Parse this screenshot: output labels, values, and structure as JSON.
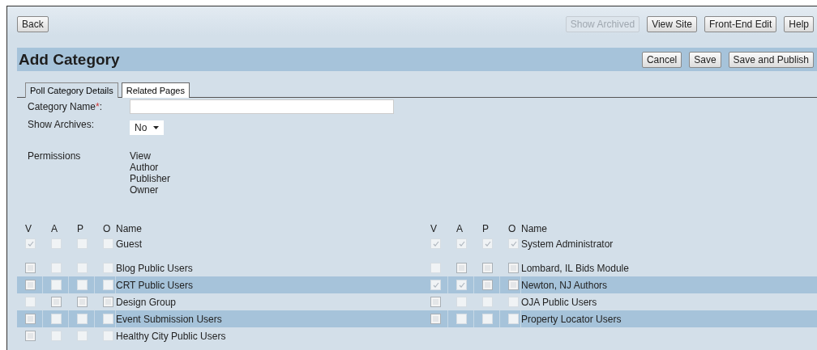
{
  "top_bar": {
    "back": "Back",
    "buttons": [
      {
        "label": "Show Archived",
        "disabled": true
      },
      {
        "label": "View Site",
        "disabled": false
      },
      {
        "label": "Front-End Edit",
        "disabled": false
      },
      {
        "label": "Help",
        "disabled": false
      }
    ]
  },
  "header": {
    "title": "Add Category",
    "buttons": [
      "Cancel",
      "Save",
      "Save and Publish"
    ]
  },
  "tabs": [
    {
      "label": "Poll Category Details",
      "selected": true
    },
    {
      "label": "Related Pages",
      "selected": false
    }
  ],
  "form": {
    "category_name": {
      "label": "Category Name",
      "required_mark": "*",
      "colon": ":"
    },
    "show_archives": {
      "label": "Show Archives:",
      "value": "No"
    }
  },
  "permissions": {
    "label": "Permissions",
    "legend": [
      "View",
      "Author",
      "Publisher",
      "Owner"
    ]
  },
  "groups": [
    {
      "columns": [
        "V",
        "A",
        "P",
        "O",
        "Name"
      ],
      "fixed": {
        "name": "Guest",
        "boxes": [
          {
            "checked": true,
            "disabled": true
          },
          {
            "checked": false,
            "disabled": true
          },
          {
            "checked": false,
            "disabled": true
          },
          {
            "checked": false,
            "disabled": true
          }
        ]
      },
      "rows": [
        {
          "name": "Blog Public Users",
          "boxes": [
            {
              "checked": false,
              "disabled": false
            },
            {
              "checked": false,
              "disabled": true
            },
            {
              "checked": false,
              "disabled": true
            },
            {
              "checked": false,
              "disabled": true
            }
          ]
        },
        {
          "name": "CRT Public Users",
          "boxes": [
            {
              "checked": false,
              "disabled": false
            },
            {
              "checked": false,
              "disabled": true
            },
            {
              "checked": false,
              "disabled": true
            },
            {
              "checked": false,
              "disabled": true
            }
          ]
        },
        {
          "name": "Design Group",
          "boxes": [
            {
              "checked": false,
              "disabled": true
            },
            {
              "checked": false,
              "disabled": false
            },
            {
              "checked": false,
              "disabled": false
            },
            {
              "checked": false,
              "disabled": false
            }
          ]
        },
        {
          "name": "Event Submission Users",
          "boxes": [
            {
              "checked": false,
              "disabled": false
            },
            {
              "checked": false,
              "disabled": true
            },
            {
              "checked": false,
              "disabled": true
            },
            {
              "checked": false,
              "disabled": true
            }
          ]
        },
        {
          "name": "Healthy City Public Users",
          "boxes": [
            {
              "checked": false,
              "disabled": false
            },
            {
              "checked": false,
              "disabled": true
            },
            {
              "checked": false,
              "disabled": true
            },
            {
              "checked": false,
              "disabled": true
            }
          ]
        }
      ]
    },
    {
      "columns": [
        "V",
        "A",
        "P",
        "O",
        "Name"
      ],
      "fixed": {
        "name": "System Administrator",
        "boxes": [
          {
            "checked": true,
            "disabled": true
          },
          {
            "checked": true,
            "disabled": true
          },
          {
            "checked": true,
            "disabled": true
          },
          {
            "checked": true,
            "disabled": true
          }
        ]
      },
      "rows": [
        {
          "name": "Lombard, IL Bids Module",
          "boxes": [
            {
              "checked": false,
              "disabled": true
            },
            {
              "checked": false,
              "disabled": false
            },
            {
              "checked": false,
              "disabled": false
            },
            {
              "checked": false,
              "disabled": false
            }
          ]
        },
        {
          "name": "Newton, NJ Authors",
          "boxes": [
            {
              "checked": true,
              "disabled": true
            },
            {
              "checked": true,
              "disabled": true
            },
            {
              "checked": false,
              "disabled": false
            },
            {
              "checked": false,
              "disabled": false
            }
          ]
        },
        {
          "name": "OJA Public Users",
          "boxes": [
            {
              "checked": false,
              "disabled": false
            },
            {
              "checked": false,
              "disabled": true
            },
            {
              "checked": false,
              "disabled": true
            },
            {
              "checked": false,
              "disabled": true
            }
          ]
        },
        {
          "name": "Property Locator Users",
          "boxes": [
            {
              "checked": false,
              "disabled": false
            },
            {
              "checked": false,
              "disabled": true
            },
            {
              "checked": false,
              "disabled": true
            },
            {
              "checked": false,
              "disabled": true
            }
          ]
        }
      ]
    }
  ]
}
